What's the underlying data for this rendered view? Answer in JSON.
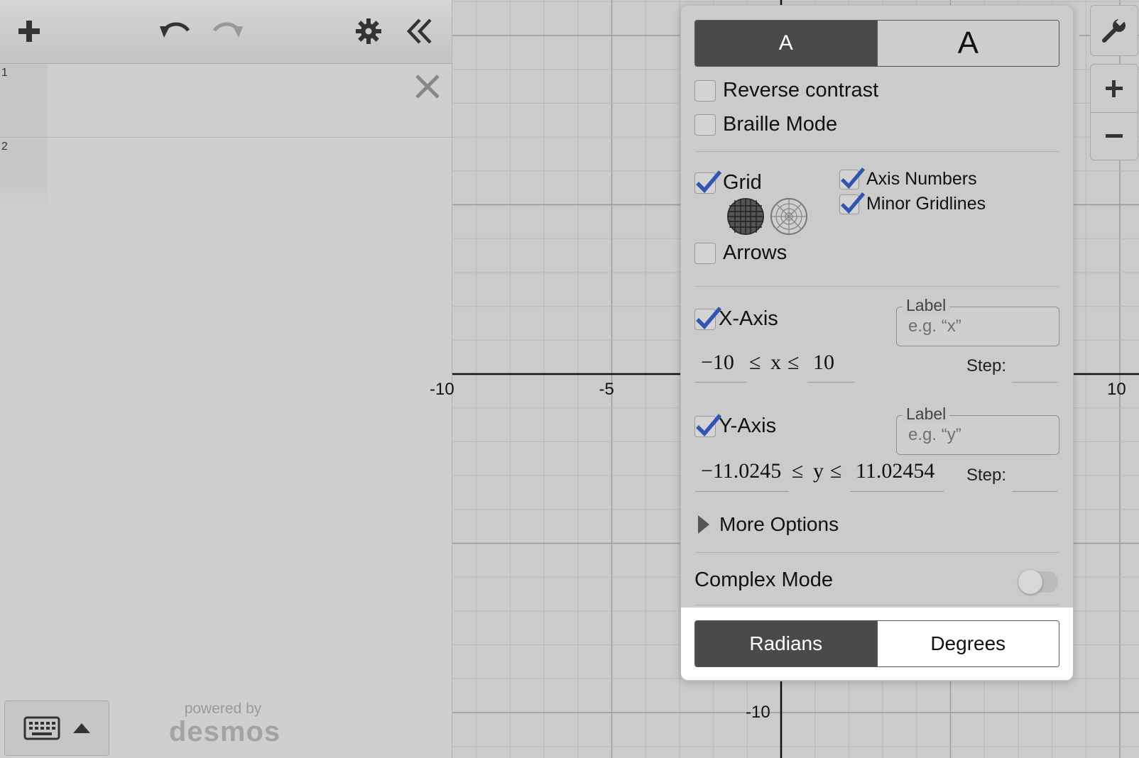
{
  "toolbar": {
    "add_icon": "plus-icon",
    "undo_icon": "undo-icon",
    "redo_icon": "redo-icon",
    "settings_icon": "gear-icon",
    "collapse_icon": "double-chevron-left-icon"
  },
  "expressions": [
    {
      "number": "1"
    },
    {
      "number": "2"
    }
  ],
  "footer": {
    "powered_by": "powered by",
    "brand": "desmos"
  },
  "graph": {
    "x_ticks": [
      {
        "value": -10,
        "label": "-10"
      },
      {
        "value": -5,
        "label": "-5"
      },
      {
        "value": 10,
        "label": "10"
      }
    ],
    "y_ticks": [
      {
        "value": -10,
        "label": "-10"
      }
    ]
  },
  "settings": {
    "text_size": {
      "small": "A",
      "large": "A",
      "selected": "small"
    },
    "reverse_contrast": {
      "label": "Reverse contrast",
      "checked": false
    },
    "braille_mode": {
      "label": "Braille Mode",
      "checked": false
    },
    "grid": {
      "label": "Grid",
      "checked": true
    },
    "axis_numbers": {
      "label": "Axis Numbers",
      "checked": true
    },
    "minor_gridlines": {
      "label": "Minor Gridlines",
      "checked": true
    },
    "arrows": {
      "label": "Arrows",
      "checked": false
    },
    "x_axis": {
      "label": "X-Axis",
      "checked": true,
      "label_field_legend": "Label",
      "label_placeholder": "e.g. “x”",
      "min": "−10",
      "var": "x",
      "max": "10",
      "step_label": "Step:"
    },
    "y_axis": {
      "label": "Y-Axis",
      "checked": true,
      "label_field_legend": "Label",
      "label_placeholder": "e.g. “y”",
      "min": "−11.0245",
      "var": "y",
      "max": "11.02454",
      "step_label": "Step:"
    },
    "leq": "≤",
    "more_options": "More Options",
    "complex_mode": {
      "label": "Complex Mode",
      "on": false
    },
    "angle": {
      "radians": "Radians",
      "degrees": "Degrees",
      "selected": "radians"
    }
  },
  "side_controls": {
    "wrench_icon": "wrench-icon",
    "zoom_in_icon": "plus-icon",
    "zoom_out_icon": "minus-icon"
  },
  "colors": {
    "check": "#2f55b5",
    "segment_on": "#4a4a4a",
    "panel_bg": "#cbcbcb"
  }
}
